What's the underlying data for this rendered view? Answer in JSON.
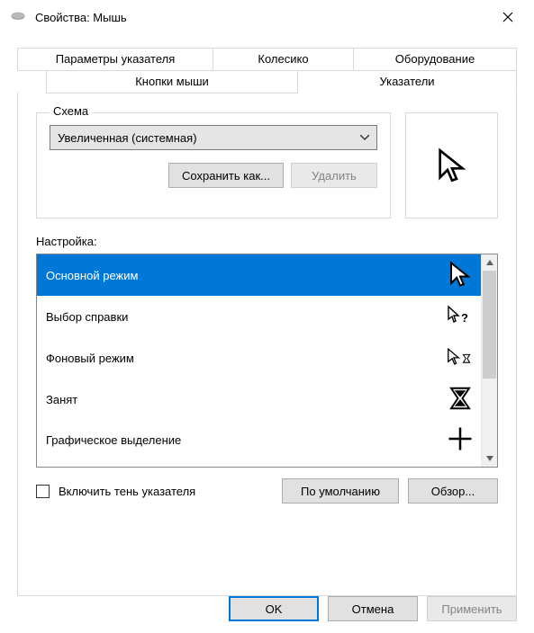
{
  "titlebar": {
    "title": "Свойства: Мышь"
  },
  "tabs": {
    "row2": [
      "Параметры указателя",
      "Колесико",
      "Оборудование"
    ],
    "row1": [
      "Кнопки мыши",
      "Указатели"
    ],
    "active": "Указатели"
  },
  "scheme": {
    "legend": "Схема",
    "selected": "Увеличенная (системная)",
    "save_as_label": "Сохранить как...",
    "delete_label": "Удалить"
  },
  "customize": {
    "label": "Настройка:",
    "items": [
      {
        "name": "Основной режим",
        "icon": "cursor-arrow"
      },
      {
        "name": "Выбор справки",
        "icon": "cursor-help"
      },
      {
        "name": "Фоновый режим",
        "icon": "cursor-working"
      },
      {
        "name": "Занят",
        "icon": "cursor-busy"
      },
      {
        "name": "Графическое выделение",
        "icon": "cursor-cross"
      }
    ],
    "selected_index": 0
  },
  "shadow_checkbox_label": "Включить тень указателя",
  "defaults_label": "По умолчанию",
  "browse_label": "Обзор...",
  "footer": {
    "ok": "OK",
    "cancel": "Отмена",
    "apply": "Применить"
  }
}
